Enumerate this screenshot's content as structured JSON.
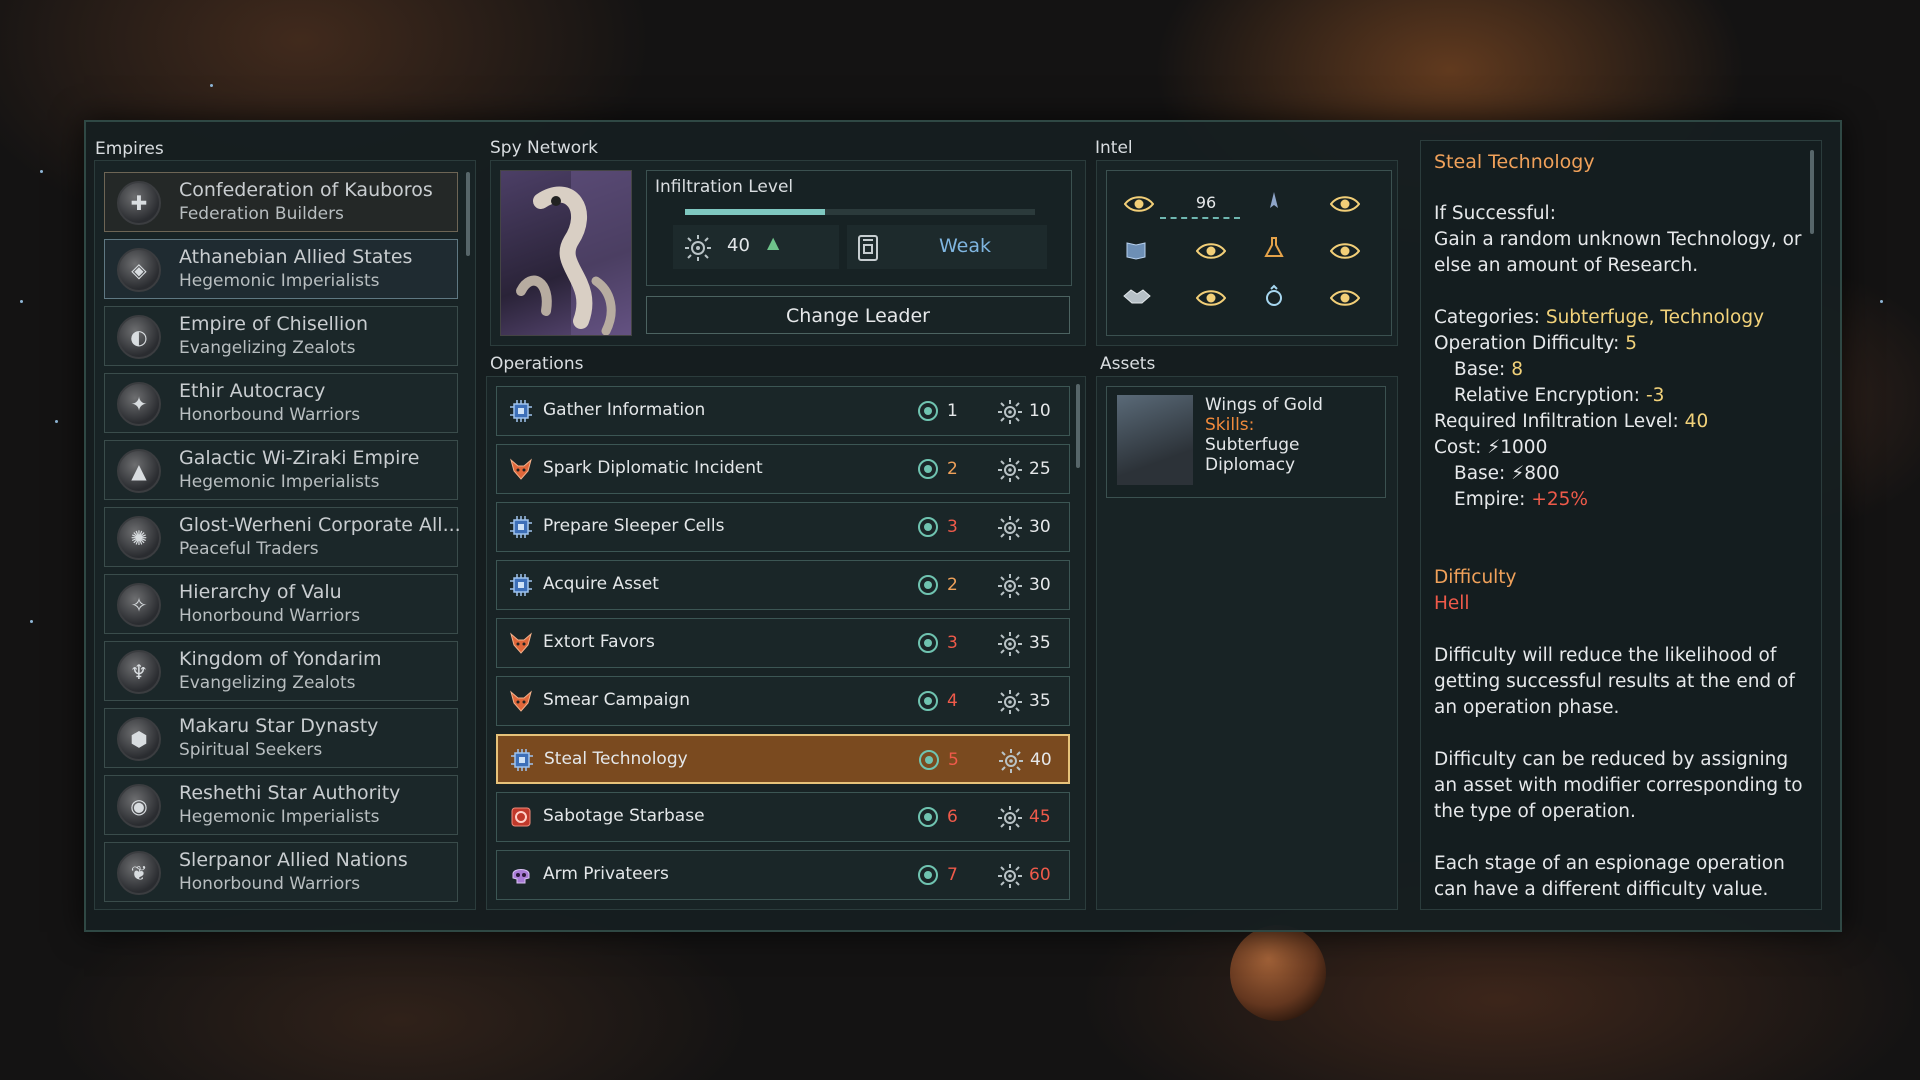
{
  "sections": {
    "empires": "Empires",
    "spy_network": "Spy Network",
    "intel": "Intel",
    "operations": "Operations",
    "assets": "Assets"
  },
  "empires": [
    {
      "name": "Confederation of Kauboros",
      "type": "Federation Builders",
      "symbol": "✚"
    },
    {
      "name": "Athanebian Allied States",
      "type": "Hegemonic Imperialists",
      "symbol": "◈"
    },
    {
      "name": "Empire of Chisellion",
      "type": "Evangelizing Zealots",
      "symbol": "◐"
    },
    {
      "name": "Ethir Autocracy",
      "type": "Honorbound Warriors",
      "symbol": "✦"
    },
    {
      "name": "Galactic Wi-Ziraki Empire",
      "type": "Hegemonic Imperialists",
      "symbol": "▲"
    },
    {
      "name": "Glost-Werheni Corporate All...",
      "type": "Peaceful Traders",
      "symbol": "✺"
    },
    {
      "name": "Hierarchy of Valu",
      "type": "Honorbound Warriors",
      "symbol": "✧"
    },
    {
      "name": "Kingdom of Yondarim",
      "type": "Evangelizing Zealots",
      "symbol": "♆"
    },
    {
      "name": "Makaru Star Dynasty",
      "type": "Spiritual Seekers",
      "symbol": "⬢"
    },
    {
      "name": "Reshethi Star Authority",
      "type": "Hegemonic Imperialists",
      "symbol": "◉"
    },
    {
      "name": "Slerpanor Allied Nations",
      "type": "Honorbound Warriors",
      "symbol": "❦"
    }
  ],
  "spy_network": {
    "infiltration_label": "Infiltration Level",
    "infiltration_value": "40",
    "infiltration_fraction": 0.4,
    "up_arrow": "▲",
    "strength": "Weak",
    "change_leader": "Change Leader"
  },
  "intel": {
    "value": "96",
    "icons": [
      "eye-icon",
      "ship-icon",
      "eye-icon",
      "book-icon",
      "eye-icon",
      "science-icon",
      "eye-icon",
      "handshake-icon",
      "eye-icon",
      "ring-icon",
      "eye-icon"
    ]
  },
  "operations": [
    {
      "name": "Gather Information",
      "difficulty": "1",
      "infiltration": "10",
      "icon": "chip",
      "diff_color": "#e6e8ea",
      "inf_color": "#e6e8ea"
    },
    {
      "name": "Spark Diplomatic Incident",
      "difficulty": "2",
      "infiltration": "25",
      "icon": "fox",
      "diff_color": "#f0a15a",
      "inf_color": "#e6e8ea"
    },
    {
      "name": "Prepare Sleeper Cells",
      "difficulty": "3",
      "infiltration": "30",
      "icon": "chip",
      "diff_color": "#ef5a4a",
      "inf_color": "#e6e8ea"
    },
    {
      "name": "Acquire Asset",
      "difficulty": "2",
      "infiltration": "30",
      "icon": "chip",
      "diff_color": "#f0a15a",
      "inf_color": "#e6e8ea"
    },
    {
      "name": "Extort Favors",
      "difficulty": "3",
      "infiltration": "35",
      "icon": "fox",
      "diff_color": "#ef5a4a",
      "inf_color": "#e6e8ea"
    },
    {
      "name": "Smear Campaign",
      "difficulty": "4",
      "infiltration": "35",
      "icon": "fox",
      "diff_color": "#ef5a4a",
      "inf_color": "#e6e8ea"
    },
    {
      "name": "Steal Technology",
      "difficulty": "5",
      "infiltration": "40",
      "icon": "chip",
      "diff_color": "#ef5a4a",
      "inf_color": "#e6e8ea"
    },
    {
      "name": "Sabotage Starbase",
      "difficulty": "6",
      "infiltration": "45",
      "icon": "sabotage",
      "diff_color": "#ef5a4a",
      "inf_color": "#ef5a4a"
    },
    {
      "name": "Arm Privateers",
      "difficulty": "7",
      "infiltration": "60",
      "icon": "skull",
      "diff_color": "#ef5a4a",
      "inf_color": "#ef5a4a"
    }
  ],
  "asset": {
    "name": "Wings of Gold",
    "skills_label": "Skills:",
    "skill_1": "Subterfuge",
    "skill_2": "Diplomacy"
  },
  "detail": {
    "title": "Steal Technology",
    "if_successful": "If Successful:",
    "success_1": "Gain a random unknown Technology, or",
    "success_2": "else an amount of Research.",
    "categories_label": "Categories:",
    "categories_value": "Subterfuge, Technology",
    "op_difficulty_label": "Operation Difficulty:",
    "op_difficulty_value": "5",
    "base_label": "Base:",
    "base_value": "8",
    "rel_enc_label": "Relative Encryption:",
    "rel_enc_value": "-3",
    "req_inf_label": "Required Infiltration Level:",
    "req_inf_value": "40",
    "cost_label": "Cost:",
    "cost_value": "1000",
    "cost_base_label": "Base:",
    "cost_base_value": "800",
    "empire_label": "Empire:",
    "empire_value": "+25%",
    "difficulty_heading": "Difficulty",
    "difficulty_value": "Hell",
    "p1_1": "Difficulty will reduce the likelihood of",
    "p1_2": "getting successful results at the end of",
    "p1_3": "an operation phase.",
    "p2_1": "Difficulty can be reduced by assigning",
    "p2_2": "an asset with modifier corresponding to",
    "p2_3": "the type of operation.",
    "p3_1": "Each stage of an espionage operation",
    "p3_2": "can have a different difficulty value.",
    "energy_symbol": "⚡"
  }
}
